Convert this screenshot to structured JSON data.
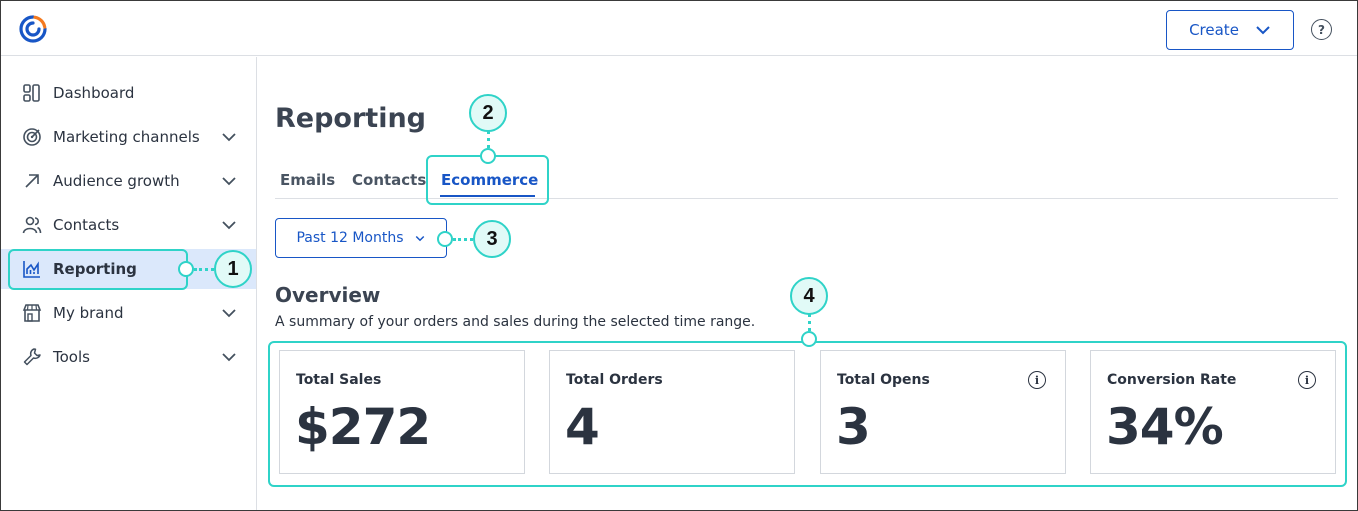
{
  "header": {
    "create_label": "Create",
    "icons": [
      "logo-icon",
      "chevron-down-icon",
      "help-icon"
    ],
    "help_glyph": "?"
  },
  "sidebar": {
    "items": [
      {
        "label": "Dashboard",
        "icon": "dashboard-icon",
        "expandable": false
      },
      {
        "label": "Marketing channels",
        "icon": "target-icon",
        "expandable": true
      },
      {
        "label": "Audience growth",
        "icon": "arrow-up-right-icon",
        "expandable": true
      },
      {
        "label": "Contacts",
        "icon": "people-icon",
        "expandable": true
      },
      {
        "label": "Reporting",
        "icon": "chart-icon",
        "expandable": false,
        "active": true
      },
      {
        "label": "My brand",
        "icon": "storefront-icon",
        "expandable": true
      },
      {
        "label": "Tools",
        "icon": "wrench-icon",
        "expandable": true
      }
    ]
  },
  "main": {
    "title": "Reporting",
    "tabs": [
      {
        "label": "Emails"
      },
      {
        "label": "Contacts"
      },
      {
        "label": "Ecommerce",
        "active": true
      }
    ],
    "range": {
      "label": "Past 12 Months"
    },
    "overview": {
      "title": "Overview",
      "subtitle": "A summary of your orders and sales during the selected time range."
    },
    "cards": [
      {
        "title": "Total Sales",
        "value": "$272",
        "info": false
      },
      {
        "title": "Total Orders",
        "value": "4",
        "info": false
      },
      {
        "title": "Total Opens",
        "value": "3",
        "info": true
      },
      {
        "title": "Conversion Rate",
        "value": "34%",
        "info": true
      }
    ],
    "info_glyph": "i"
  },
  "callouts": {
    "c1": "1",
    "c2": "2",
    "c3": "3",
    "c4": "4"
  },
  "colors": {
    "accent": "#1856c6",
    "active_bg": "#dbe8fb",
    "callout": "#2fd3c8",
    "text": "#2b3340"
  }
}
